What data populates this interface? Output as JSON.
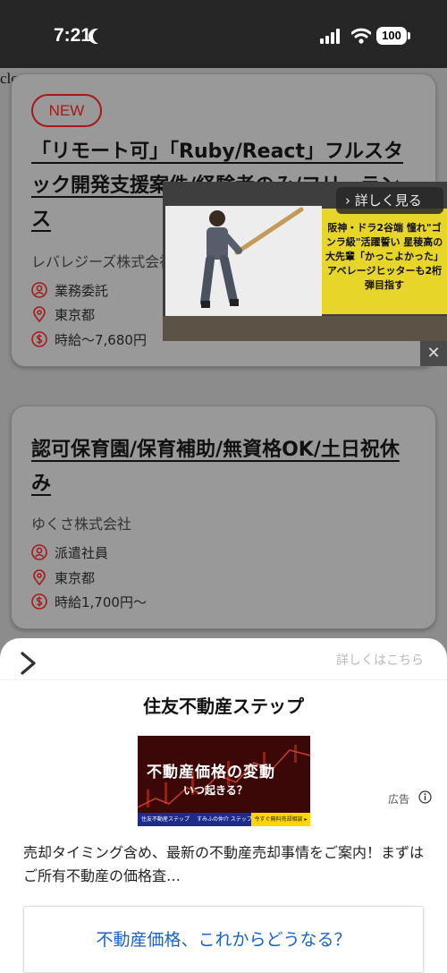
{
  "status_bar": {
    "time": "7:21",
    "battery": "100"
  },
  "close_text": "close",
  "job_cards": [
    {
      "badge": "NEW",
      "title": "「リモート可」「Ruby/React」フルスタック開発支援案件/経験者のみ/フリーランス",
      "company": "レバレジーズ株式会社",
      "employment_type": "業務委託",
      "location": "東京都",
      "salary": "時給〜7,680円"
    },
    {
      "title": "認可保育園/保育補助/無資格OK/土日祝休み",
      "company": "ゆくさ株式会社",
      "employment_type": "派遣社員",
      "location": "東京都",
      "salary": "時給1,700円〜"
    }
  ],
  "video_ad": {
    "more_label": "詳しく見る",
    "caption": "阪神・ドラ2谷端 憧れ\"ゴンラ級\"活躍誓い 星稜高の大先輩「かっこよかった」アベレージヒッターも2桁弾目指す",
    "close_symbol": "✕"
  },
  "bottom_ad": {
    "more_link": "詳しくはこちら",
    "advertiser": "住友不動産ステップ",
    "banner": {
      "headline": "不動産価格の変動",
      "subhead": "いつ起きる？",
      "footer_left": "住友不動産ステップ",
      "footer_middle": "すみふの仲介 ステップ",
      "footer_cta": "今すぐ無料売却相談 ▸"
    },
    "ad_label": "広告",
    "description": "売却タイミング含め、最新の不動産売却事情をご案内！まずはご所有不動産の価格査…",
    "cta": "不動産価格、これからどうなる？"
  },
  "colors": {
    "accent_red": "#a61919",
    "link_blue": "#1a62c9",
    "overlay": "#8c8c8c"
  }
}
